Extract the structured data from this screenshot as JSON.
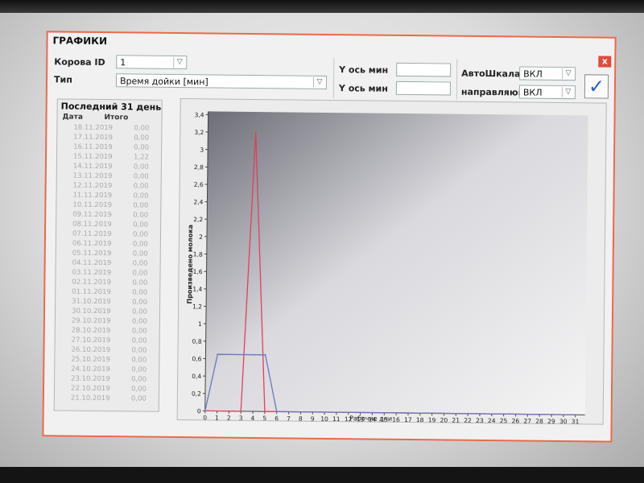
{
  "window": {
    "title": "ГРАФИКИ",
    "close_label": "x"
  },
  "controls": {
    "cow_id": {
      "label": "Корова ID",
      "value": "1"
    },
    "type": {
      "label": "Тип",
      "value": "Время дойки [мин]"
    },
    "y_axis_min_1": {
      "label": "Y ось мин",
      "value": ""
    },
    "y_axis_min_2": {
      "label": "Y ось мин",
      "value": ""
    },
    "auto_scale": {
      "label": "АвтоШкала",
      "value": "ВКЛ"
    },
    "direction": {
      "label": "направляющ",
      "value": "ВКЛ"
    },
    "confirm_icon": "checkmark-icon"
  },
  "list": {
    "header": "Последний 31 день",
    "columns": [
      "Дата",
      "Итого"
    ],
    "rows": [
      [
        "18.11.2019",
        "0,00"
      ],
      [
        "17.11.2019",
        "0,00"
      ],
      [
        "16.11.2019",
        "0,00"
      ],
      [
        "15.11.2019",
        "1,22"
      ],
      [
        "14.11.2019",
        "0,00"
      ],
      [
        "13.11.2019",
        "0,00"
      ],
      [
        "12.11.2019",
        "0,00"
      ],
      [
        "11.11.2019",
        "0,00"
      ],
      [
        "10.11.2019",
        "0,00"
      ],
      [
        "09.11.2019",
        "0,00"
      ],
      [
        "08.11.2019",
        "0,00"
      ],
      [
        "07.11.2019",
        "0,00"
      ],
      [
        "06.11.2019",
        "0,00"
      ],
      [
        "05.11.2019",
        "0,00"
      ],
      [
        "04.11.2019",
        "0,00"
      ],
      [
        "03.11.2019",
        "0,00"
      ],
      [
        "02.11.2019",
        "0,00"
      ],
      [
        "01.11.2019",
        "0,00"
      ],
      [
        "31.10.2019",
        "0,00"
      ],
      [
        "30.10.2019",
        "0,00"
      ],
      [
        "29.10.2019",
        "0,00"
      ],
      [
        "28.10.2019",
        "0,00"
      ],
      [
        "27.10.2019",
        "0,00"
      ],
      [
        "26.10.2019",
        "0,00"
      ],
      [
        "25.10.2019",
        "0,00"
      ],
      [
        "24.10.2019",
        "0,00"
      ],
      [
        "23.10.2019",
        "0,00"
      ],
      [
        "22.10.2019",
        "0,00"
      ],
      [
        "21.10.2019",
        "0,00"
      ]
    ]
  },
  "chart_data": {
    "type": "line",
    "xlabel": "Рабочие дни",
    "ylabel": "Произведено молока",
    "xlim": [
      0,
      31
    ],
    "ylim": [
      0,
      3.4
    ],
    "x_ticks": [
      "0",
      "1",
      "2",
      "3",
      "4",
      "5",
      "6",
      "7",
      "8",
      "9",
      "10",
      "11",
      "12",
      "13",
      "14",
      "15",
      "16",
      "17",
      "18",
      "19",
      "20",
      "21",
      "22",
      "23",
      "24",
      "25",
      "26",
      "27",
      "28",
      "29",
      "30",
      "31"
    ],
    "y_ticks": [
      "0",
      "0,2",
      "0,4",
      "0,6",
      "0,8",
      "1",
      "1,2",
      "1,4",
      "1,6",
      "1,8",
      "2",
      "2,2",
      "2,4",
      "2,6",
      "2,8",
      "3",
      "3,2",
      "3,4"
    ],
    "grid": false,
    "series": [
      {
        "color": "#e0405a",
        "x": [
          0,
          3,
          4,
          5,
          31
        ],
        "y": [
          0,
          0,
          3.2,
          0,
          0
        ]
      },
      {
        "color": "#6a78b8",
        "x": [
          0,
          1,
          5,
          6,
          31
        ],
        "y": [
          0,
          0.65,
          0.65,
          0,
          0
        ]
      }
    ]
  }
}
